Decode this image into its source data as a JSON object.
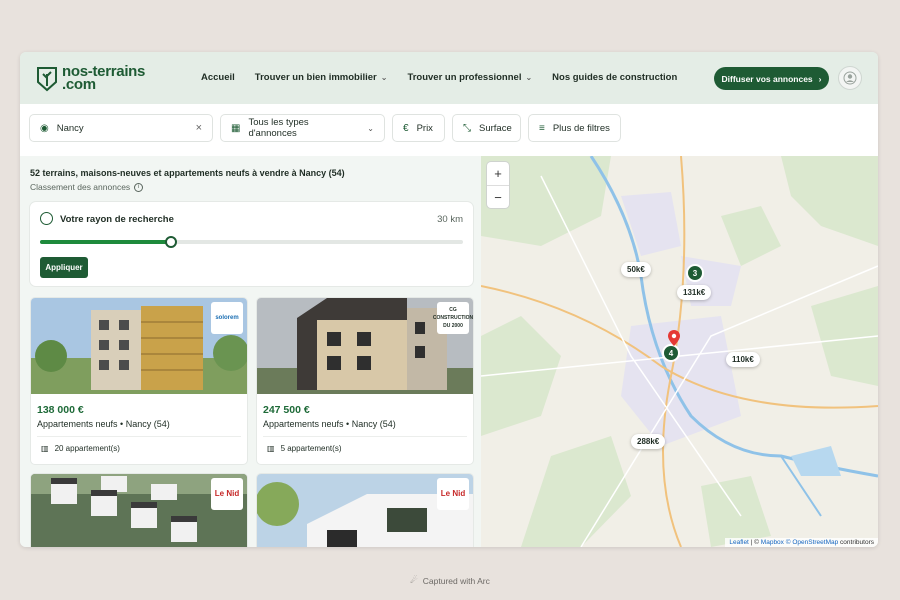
{
  "header": {
    "logo_line1": "nos-terrains",
    "logo_line2": ".com",
    "nav": [
      {
        "label": "Accueil",
        "dropdown": false
      },
      {
        "label": "Trouver un bien immobilier",
        "dropdown": true
      },
      {
        "label": "Trouver un professionnel",
        "dropdown": true
      },
      {
        "label": "Nos guides de construction",
        "dropdown": false
      }
    ],
    "cta_label": "Diffuser vos annonces",
    "cta_arrow": "›"
  },
  "filters": {
    "location_value": "Nancy",
    "clear_glyph": "×",
    "type_label": "Tous les types d'annonces",
    "price_label": "Prix",
    "price_glyph": "€",
    "surface_label": "Surface",
    "more_label": "Plus de filtres"
  },
  "results": {
    "title": "52 terrains, maisons-neuves et appartements neufs à vendre à Nancy (54)",
    "sort_label": "Classement des annonces",
    "radius": {
      "title": "Votre rayon de recherche",
      "value": "30 km",
      "level_fraction": 0.31,
      "apply_label": "Appliquer"
    },
    "cards": [
      {
        "price": "138 000 €",
        "type": "Appartements neufs • Nancy (54)",
        "count": "20 appartement(s)",
        "badge": "solorem"
      },
      {
        "price": "247 500 €",
        "type": "Appartements neufs • Nancy (54)",
        "count": "5 appartement(s)",
        "badge": "CG CONSTRUCTION DU 2000"
      },
      {
        "badge": "Le Nid"
      },
      {
        "badge": "Le Nid"
      }
    ]
  },
  "map": {
    "zoom_in": "+",
    "zoom_out": "−",
    "price_pins": [
      "50k€",
      "131k€",
      "110k€",
      "288k€"
    ],
    "clusters": [
      "3",
      "4"
    ],
    "attribution": {
      "leaflet": "Leaflet",
      "sep": "| ©",
      "mapbox": "Mapbox",
      "osm": "© OpenStreetMap",
      "contributors": "contributors"
    }
  },
  "footer": {
    "label": "Captured with Arc"
  },
  "colors": {
    "brand": "#1e5b34",
    "price": "#1e6a38",
    "accent": "#1e8a3c"
  }
}
